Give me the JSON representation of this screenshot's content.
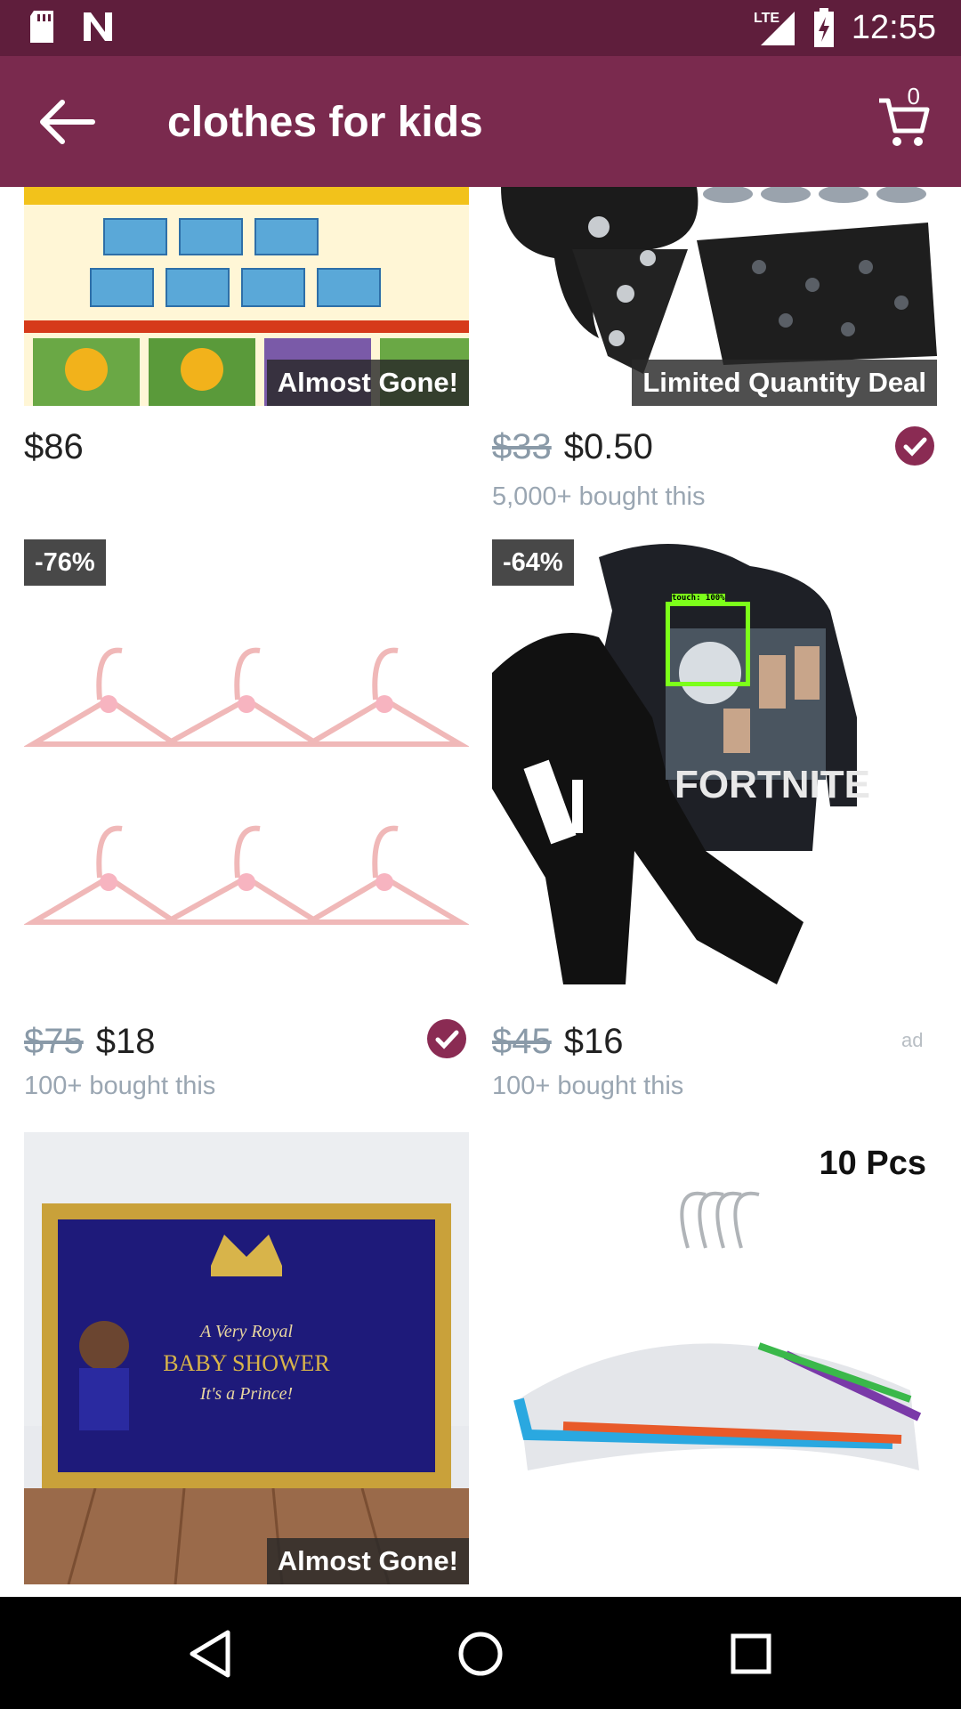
{
  "status_bar": {
    "time": "12:55",
    "network": "LTE",
    "icons": [
      "sd-card-icon",
      "n-notification-icon",
      "signal-icon",
      "battery-charging-icon"
    ]
  },
  "app_bar": {
    "title": "clothes for kids",
    "cart_count": "0",
    "back_icon": "arrow-left-icon",
    "cart_icon": "cart-icon"
  },
  "colors": {
    "status_bar": "#5f1e3c",
    "app_bar": "#7a2a4e",
    "verified_badge": "#8a2b53",
    "detection_box": "#7cff1a"
  },
  "products": [
    {
      "badge": "Almost Gone!",
      "old_price": "",
      "price": "$86",
      "bought": "",
      "verified": false
    },
    {
      "badge": "Limited Quantity Deal",
      "old_price": "$33",
      "price": "$0.50",
      "bought": "5,000+ bought this",
      "verified": true
    },
    {
      "discount": "-76%",
      "old_price": "$75",
      "price": "$18",
      "bought": "100+ bought this",
      "verified": true
    },
    {
      "discount": "-64%",
      "old_price": "$45",
      "price": "$16",
      "bought": "100+ bought this",
      "verified": false,
      "ad": "ad",
      "image_text": "FORTNITE",
      "overlay_text": "touch: 100%"
    },
    {
      "badge": "Almost Gone!",
      "image_text": [
        "A Very Royal",
        "BABY SHOWER",
        "It's a Prince!"
      ]
    },
    {
      "image_text": "10 Pcs"
    }
  ]
}
